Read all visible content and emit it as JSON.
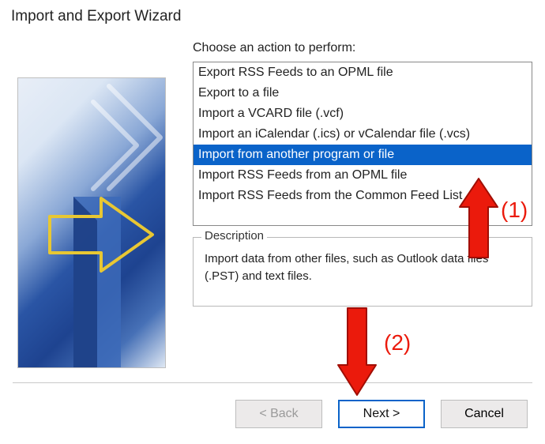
{
  "window": {
    "title": "Import and Export Wizard"
  },
  "main": {
    "choose_label": "Choose an action to perform:",
    "actions": [
      "Export RSS Feeds to an OPML file",
      "Export to a file",
      "Import a VCARD file (.vcf)",
      "Import an iCalendar (.ics) or vCalendar file (.vcs)",
      "Import from another program or file",
      "Import RSS Feeds from an OPML file",
      "Import RSS Feeds from the Common Feed List"
    ],
    "selected_index": 4
  },
  "description": {
    "legend": "Description",
    "text": "Import data from other files, such as Outlook data files (.PST) and text files."
  },
  "buttons": {
    "back": "< Back",
    "next": "Next >",
    "cancel": "Cancel"
  },
  "annotations": {
    "label1": "(1)",
    "label2": "(2)"
  }
}
